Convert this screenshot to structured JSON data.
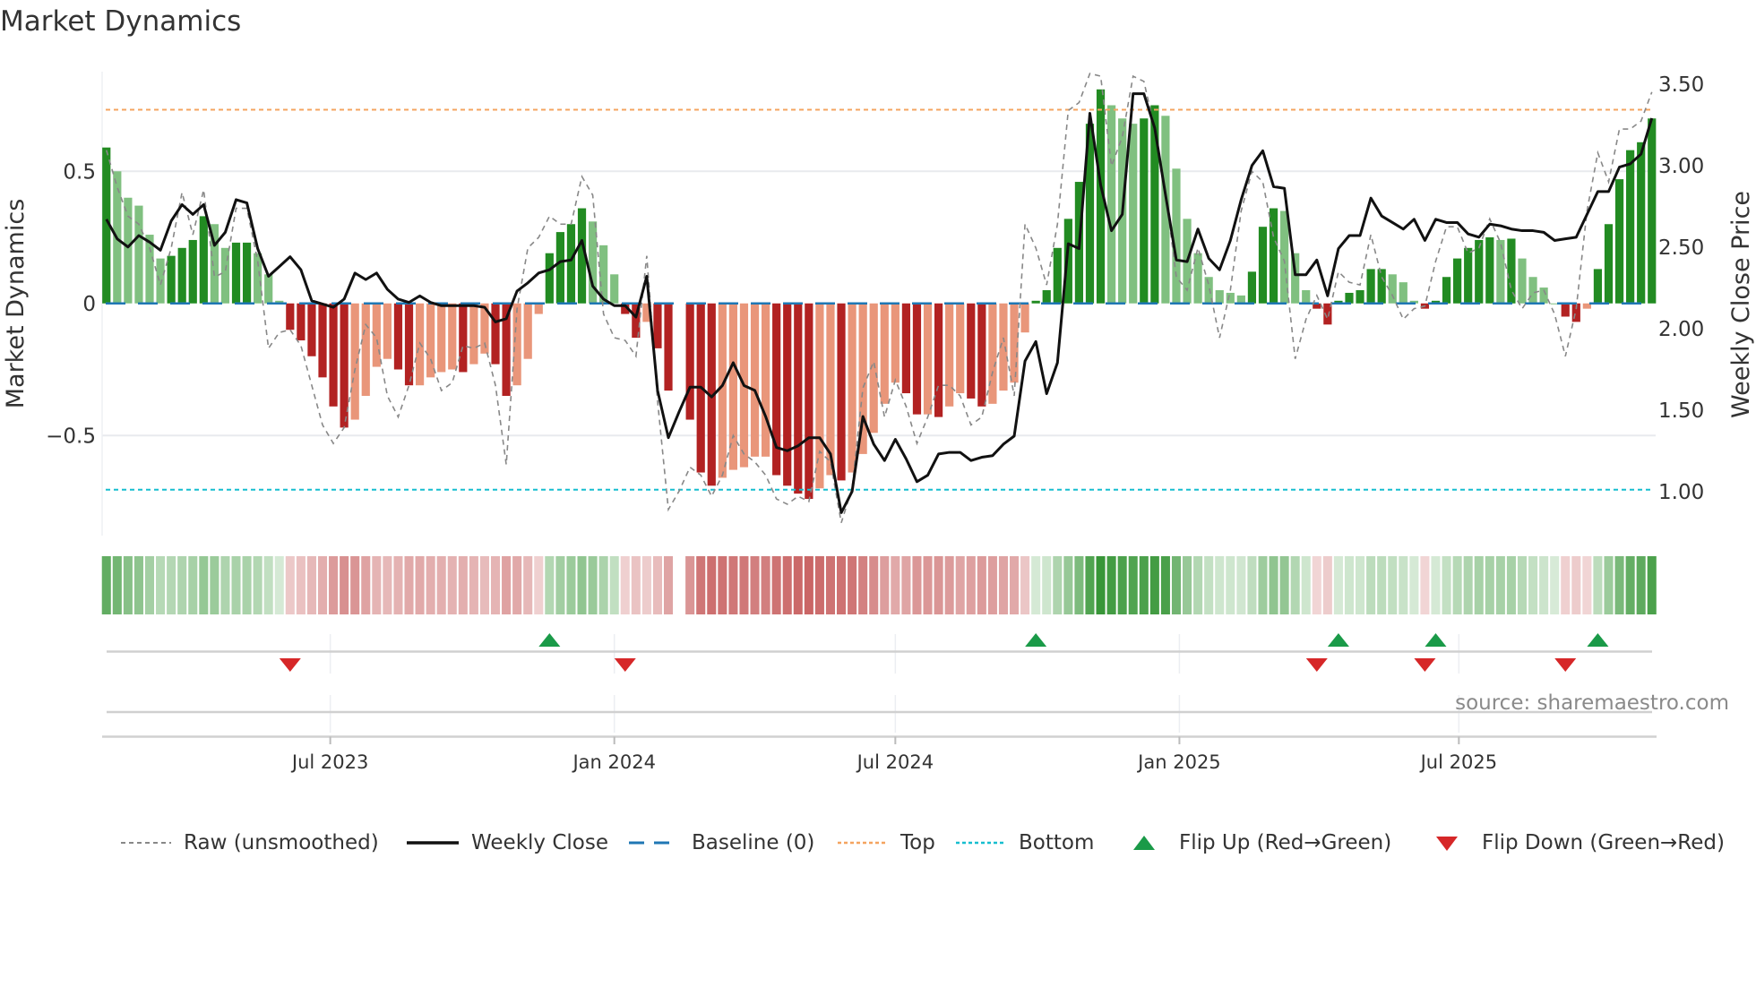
{
  "title": "Market Dynamics",
  "source": "source: sharemaestro.com",
  "legend": [
    {
      "key": "raw",
      "label": "Raw (unsmoothed)"
    },
    {
      "key": "close",
      "label": "Weekly Close"
    },
    {
      "key": "baseline",
      "label": "Baseline (0)"
    },
    {
      "key": "top",
      "label": "Top"
    },
    {
      "key": "bottom",
      "label": "Bottom"
    },
    {
      "key": "flip_up",
      "label": "Flip Up (Red→Green)"
    },
    {
      "key": "flip_down",
      "label": "Flip Down (Green→Red)"
    }
  ],
  "colors": {
    "green_strong": "#228b22",
    "green_light": "#80c080",
    "red_strong": "#b22222",
    "red_light": "#e9967a",
    "baseline": "#1f77b4",
    "top": "#f4a460",
    "bottom": "#17becf",
    "raw": "#888888",
    "close": "#111111",
    "flip_up": "#1a9a48",
    "flip_down": "#d62728",
    "grid": "#e8eaee"
  },
  "chart_data": {
    "type": "bar+line",
    "title": "Market Dynamics",
    "ylabel": "Market Dynamics",
    "y2label": "Weekly Close Price",
    "start_date": "2023-02-06",
    "frequency": "weekly",
    "ylim": [
      -0.88,
      0.88
    ],
    "y2lim": [
      0.72,
      3.6
    ],
    "yticks": [
      {
        "v": 0.5,
        "label": "0.5"
      },
      {
        "v": 0,
        "label": "0"
      },
      {
        "v": -0.5,
        "label": "−0.5"
      }
    ],
    "y2ticks": [
      {
        "v": 3.5,
        "label": "3.50"
      },
      {
        "v": 3.0,
        "label": "3.00"
      },
      {
        "v": 2.5,
        "label": "2.50"
      },
      {
        "v": 2.0,
        "label": "2.00"
      },
      {
        "v": 1.5,
        "label": "1.50"
      },
      {
        "v": 1.0,
        "label": "1.00"
      }
    ],
    "xticks": [
      {
        "date": "2023-07-01",
        "label": "Jul 2023"
      },
      {
        "date": "2024-01-01",
        "label": "Jan 2024"
      },
      {
        "date": "2024-07-01",
        "label": "Jul 2024"
      },
      {
        "date": "2025-01-01",
        "label": "Jan 2025"
      },
      {
        "date": "2025-07-01",
        "label": "Jul 2025"
      }
    ],
    "levels": {
      "baseline": 0,
      "top": 0.733,
      "bottom": -0.705
    },
    "dynamics": [
      0.59,
      0.5,
      0.4,
      0.37,
      0.26,
      0.17,
      0.18,
      0.21,
      0.24,
      0.33,
      0.3,
      0.21,
      0.23,
      0.23,
      0.19,
      0.11,
      0.01,
      -0.1,
      -0.14,
      -0.2,
      -0.28,
      -0.39,
      -0.47,
      -0.44,
      -0.35,
      -0.24,
      -0.21,
      -0.25,
      -0.31,
      -0.31,
      -0.28,
      -0.26,
      -0.25,
      -0.26,
      -0.23,
      -0.19,
      -0.23,
      -0.35,
      -0.31,
      -0.21,
      -0.04,
      0.19,
      0.27,
      0.3,
      0.36,
      0.31,
      0.22,
      0.11,
      -0.04,
      -0.13,
      -0.07,
      -0.17,
      -0.33,
      null,
      -0.44,
      -0.64,
      -0.69,
      -0.66,
      -0.63,
      -0.62,
      -0.58,
      -0.58,
      -0.65,
      -0.69,
      -0.72,
      -0.74,
      -0.7,
      -0.65,
      -0.67,
      -0.64,
      -0.57,
      -0.49,
      -0.38,
      -0.3,
      -0.34,
      -0.42,
      -0.42,
      -0.43,
      -0.39,
      -0.34,
      -0.36,
      -0.39,
      -0.38,
      -0.33,
      -0.3,
      -0.11,
      0.01,
      0.05,
      0.21,
      0.32,
      0.46,
      0.68,
      0.81,
      0.75,
      0.7,
      0.68,
      0.7,
      0.75,
      0.71,
      0.51,
      0.32,
      0.19,
      0.1,
      0.05,
      0.04,
      0.03,
      0.12,
      0.29,
      0.36,
      0.35,
      0.19,
      0.05,
      -0.02,
      -0.08,
      0.01,
      0.04,
      0.05,
      0.13,
      0.13,
      0.11,
      0.08,
      0.01,
      -0.02,
      0.01,
      0.1,
      0.17,
      0.21,
      0.24,
      0.25,
      0.24,
      0.245,
      0.17,
      0.1,
      0.06,
      0.0,
      -0.05,
      -0.07,
      -0.02,
      0.13,
      0.3,
      0.47,
      0.58,
      0.61,
      0.7
    ],
    "raw": [
      0.58,
      0.44,
      0.33,
      0.3,
      0.21,
      0.07,
      0.21,
      0.42,
      0.26,
      0.43,
      0.1,
      0.12,
      0.36,
      0.36,
      0.16,
      -0.17,
      -0.11,
      -0.1,
      -0.16,
      -0.31,
      -0.46,
      -0.53,
      -0.47,
      -0.25,
      -0.08,
      -0.13,
      -0.35,
      -0.43,
      -0.31,
      -0.15,
      -0.21,
      -0.33,
      -0.3,
      -0.16,
      -0.17,
      -0.15,
      -0.31,
      -0.61,
      -0.02,
      0.21,
      0.25,
      0.33,
      0.3,
      0.3,
      0.48,
      0.41,
      -0.04,
      -0.13,
      -0.14,
      -0.2,
      0.18,
      -0.37,
      -0.78,
      -0.71,
      -0.62,
      -0.65,
      -0.73,
      -0.65,
      -0.5,
      -0.57,
      -0.6,
      -0.65,
      -0.74,
      -0.76,
      -0.73,
      -0.75,
      -0.56,
      -0.6,
      -0.83,
      -0.7,
      -0.32,
      -0.22,
      -0.43,
      -0.29,
      -0.39,
      -0.53,
      -0.43,
      -0.31,
      -0.31,
      -0.35,
      -0.46,
      -0.43,
      -0.26,
      -0.13,
      -0.35,
      0.3,
      0.21,
      0.07,
      0.3,
      0.73,
      0.76,
      0.87,
      0.86,
      0.52,
      0.63,
      0.86,
      0.84,
      0.66,
      0.42,
      0.1,
      0.05,
      0.21,
      0.07,
      -0.13,
      0.05,
      0.35,
      0.5,
      0.46,
      0.25,
      0.16,
      -0.21,
      -0.06,
      0.03,
      -0.06,
      0.12,
      0.08,
      0.07,
      0.26,
      0.1,
      0.03,
      -0.06,
      -0.02,
      -0.01,
      0.16,
      0.29,
      0.29,
      0.19,
      0.21,
      0.32,
      0.23,
      0.05,
      -0.02,
      0.04,
      0.05,
      -0.04,
      -0.2,
      -0.02,
      0.35,
      0.57,
      0.46,
      0.66,
      0.66,
      0.69,
      0.8
    ],
    "close": [
      2.67,
      2.55,
      2.5,
      2.57,
      2.53,
      2.48,
      2.66,
      2.76,
      2.7,
      2.76,
      2.51,
      2.59,
      2.79,
      2.77,
      2.49,
      2.32,
      2.38,
      2.44,
      2.36,
      2.17,
      2.15,
      2.13,
      2.18,
      2.34,
      2.3,
      2.34,
      2.24,
      2.18,
      2.16,
      2.2,
      2.16,
      2.14,
      2.14,
      2.14,
      2.14,
      2.13,
      2.04,
      2.06,
      2.23,
      2.28,
      2.34,
      2.36,
      2.41,
      2.42,
      2.54,
      2.26,
      2.18,
      2.14,
      2.14,
      2.07,
      2.32,
      1.62,
      1.33,
      1.49,
      1.64,
      1.64,
      1.58,
      1.65,
      1.79,
      1.65,
      1.62,
      1.46,
      1.27,
      1.25,
      1.28,
      1.33,
      1.33,
      1.23,
      0.87,
      1.0,
      1.46,
      1.29,
      1.19,
      1.32,
      1.2,
      1.06,
      1.1,
      1.23,
      1.24,
      1.24,
      1.19,
      1.21,
      1.22,
      1.29,
      1.34,
      1.8,
      1.92,
      1.6,
      1.79,
      2.52,
      2.49,
      3.32,
      2.88,
      2.6,
      2.7,
      3.44,
      3.44,
      3.23,
      2.82,
      2.42,
      2.41,
      2.61,
      2.43,
      2.36,
      2.54,
      2.79,
      3.0,
      3.09,
      2.87,
      2.86,
      2.33,
      2.33,
      2.42,
      2.2,
      2.49,
      2.57,
      2.57,
      2.8,
      2.69,
      2.65,
      2.61,
      2.67,
      2.54,
      2.67,
      2.65,
      2.65,
      2.58,
      2.56,
      2.64,
      2.63,
      2.61,
      2.6,
      2.6,
      2.59,
      2.54,
      2.55,
      2.56,
      2.7,
      2.84,
      2.84,
      2.99,
      3.01,
      3.07,
      3.29
    ],
    "flip_up_dates": [
      "2023-11-20",
      "2024-09-30",
      "2025-04-14",
      "2025-06-16",
      "2025-09-29"
    ],
    "flip_down_dates": [
      "2023-06-05",
      "2024-01-08",
      "2025-03-31",
      "2025-06-09",
      "2025-09-08"
    ],
    "grid": true,
    "legend_position": "bottom"
  }
}
